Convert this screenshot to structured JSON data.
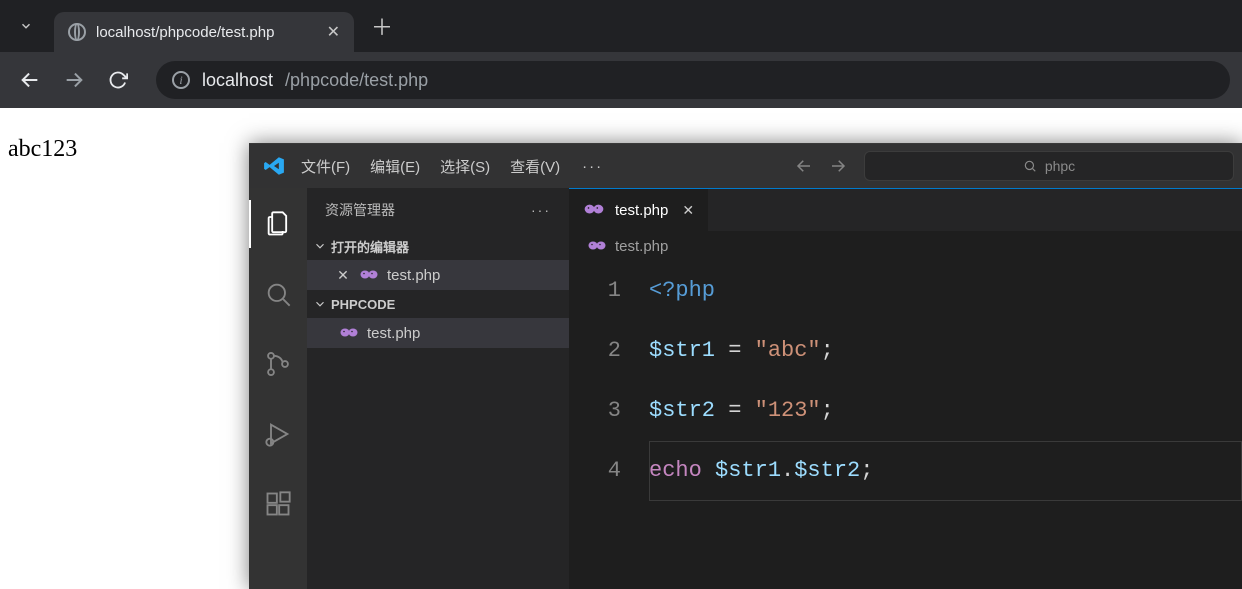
{
  "browser": {
    "tab_title": "localhost/phpcode/test.php",
    "url_host": "localhost",
    "url_path": "/phpcode/test.php"
  },
  "page_output": "abc123",
  "vscode": {
    "menus": [
      "文件(F)",
      "编辑(E)",
      "选择(S)",
      "查看(V)"
    ],
    "title_search_text": "phpc",
    "explorer_title": "资源管理器",
    "sections": {
      "open_editors": "打开的编辑器",
      "folder": "PHPCODE"
    },
    "open_editor_file": "test.php",
    "folder_file": "test.php",
    "tab_file": "test.php",
    "breadcrumb_file": "test.php",
    "code": {
      "line_numbers": [
        "1",
        "2",
        "3",
        "4"
      ],
      "l1": {
        "open": "<?",
        "php": "php"
      },
      "l2": {
        "var": "$str1",
        "eq": " = ",
        "str": "\"abc\"",
        "semi": ";"
      },
      "l3": {
        "var": "$str2",
        "eq": " = ",
        "str": "\"123\"",
        "semi": ";"
      },
      "l4": {
        "echo": "echo ",
        "v1": "$str1",
        "dot": ".",
        "v2": "$str2",
        "semi": ";"
      }
    }
  }
}
